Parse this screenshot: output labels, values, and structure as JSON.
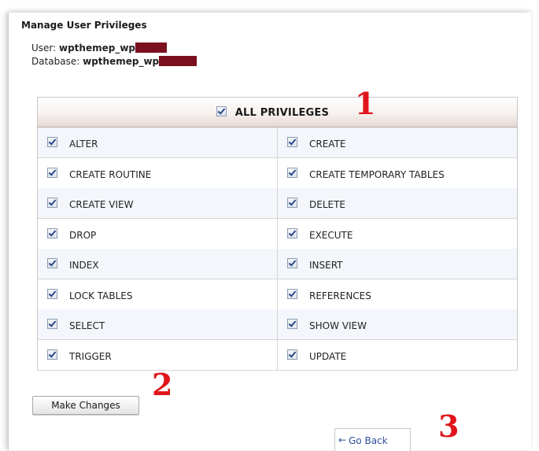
{
  "page": {
    "title": "Manage User Privileges",
    "user_label": "User: ",
    "user_value": "wpthemep_wp",
    "database_label": "Database: ",
    "database_value": "wpthemep_wp"
  },
  "privileges": {
    "all_label": "ALL PRIVILEGES",
    "all_checked": true,
    "rows": [
      {
        "left": {
          "label": "ALTER",
          "checked": true
        },
        "right": {
          "label": "CREATE",
          "checked": true
        }
      },
      {
        "left": {
          "label": "CREATE ROUTINE",
          "checked": true
        },
        "right": {
          "label": "CREATE TEMPORARY TABLES",
          "checked": true
        }
      },
      {
        "left": {
          "label": "CREATE VIEW",
          "checked": true
        },
        "right": {
          "label": "DELETE",
          "checked": true
        }
      },
      {
        "left": {
          "label": "DROP",
          "checked": true
        },
        "right": {
          "label": "EXECUTE",
          "checked": true
        }
      },
      {
        "left": {
          "label": "INDEX",
          "checked": true
        },
        "right": {
          "label": "INSERT",
          "checked": true
        }
      },
      {
        "left": {
          "label": "LOCK TABLES",
          "checked": true
        },
        "right": {
          "label": "REFERENCES",
          "checked": true
        }
      },
      {
        "left": {
          "label": "SELECT",
          "checked": true
        },
        "right": {
          "label": "SHOW VIEW",
          "checked": true
        }
      },
      {
        "left": {
          "label": "TRIGGER",
          "checked": true
        },
        "right": {
          "label": "UPDATE",
          "checked": true
        }
      }
    ]
  },
  "annotations": [
    "1",
    "2",
    "3"
  ],
  "buttons": {
    "make_changes": "Make Changes",
    "go_back": "Go Back",
    "go_back_icon": "arrow-left-icon"
  },
  "colors": {
    "annotation": "#e0151b",
    "redaction": "#7a0f1e",
    "link": "#2d4f9a"
  }
}
